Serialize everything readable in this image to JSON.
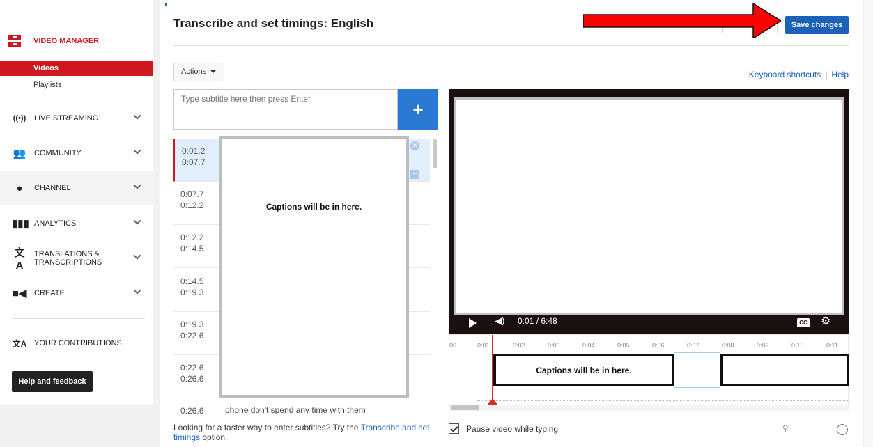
{
  "sidebar": {
    "brand": "VIDEO MANAGER",
    "sub_items": [
      "Videos",
      "Playlists"
    ],
    "sections": [
      {
        "label": "LIVE STREAMING",
        "icon": "live-streaming-icon"
      },
      {
        "label": "COMMUNITY",
        "icon": "community-icon"
      },
      {
        "label": "CHANNEL",
        "icon": "channel-icon"
      },
      {
        "label": "ANALYTICS",
        "icon": "analytics-icon"
      },
      {
        "label": "TRANSLATIONS &\nTRANSCRIPTIONS",
        "icon": "translate-icon"
      },
      {
        "label": "CREATE",
        "icon": "create-icon"
      }
    ],
    "contributions": "YOUR CONTRIBUTIONS",
    "help_button": "Help and feedback"
  },
  "header": {
    "title": "Transcribe and set timings: English",
    "save_button": "Save changes"
  },
  "toolbar": {
    "actions": "Actions",
    "keyboard_shortcuts": "Keyboard shortcuts",
    "separator": "|",
    "help": "Help"
  },
  "editor": {
    "input_placeholder": "Type subtitle here then press Enter",
    "add_button": "+",
    "rows": [
      {
        "times": "0:01.2\n0:07.7",
        "text": ""
      },
      {
        "times": "0:07.7\n0:12.2",
        "text": ""
      },
      {
        "times": "0:12.2\n0:14.5",
        "text": ""
      },
      {
        "times": "0:14.5\n0:19.3",
        "text": ""
      },
      {
        "times": "0:19.3\n0:22.6",
        "text": ""
      },
      {
        "times": "0:22.6\n0:26.6",
        "text": ""
      },
      {
        "times": "0:26.6",
        "text": "phone don't spend any time with them"
      }
    ],
    "captions_overlay": "Captions will be in here.",
    "faster_text": "Looking for a faster way to enter subtitles? Try the ",
    "faster_link": "Transcribe and set timings",
    "faster_suffix": " option."
  },
  "player": {
    "timecode": "0:01 / 6:48",
    "cc": "CC"
  },
  "timeline": {
    "ticks": [
      "00",
      "0:01",
      "0:02",
      "0:03",
      "0:04",
      "0:05",
      "0:06",
      "0:07",
      "0:08",
      "0:09",
      "0:10",
      "0:11"
    ],
    "caption_overlay": "Captions will be in here."
  },
  "options": {
    "pause_label": "Pause video while typing",
    "pause_checked": true
  },
  "colors": {
    "brand_red": "#cc181e",
    "primary_blue": "#1c62b9",
    "annotation_arrow": "#ff0000"
  }
}
